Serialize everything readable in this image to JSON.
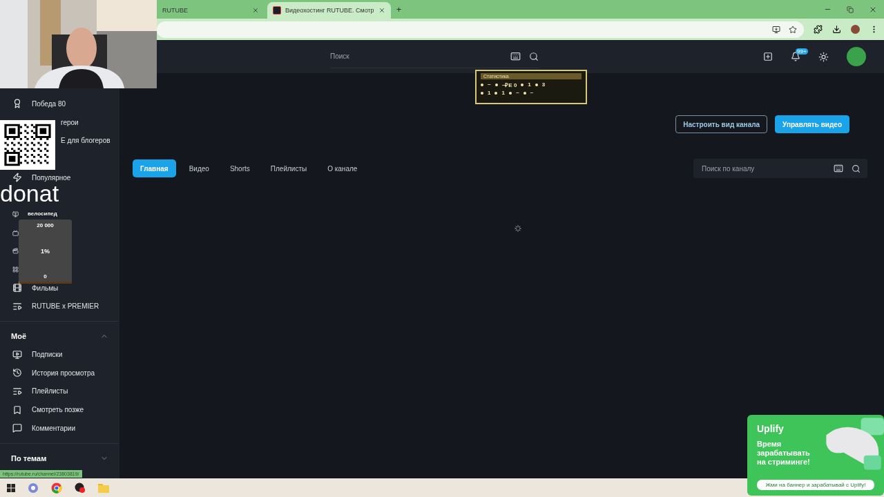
{
  "browser": {
    "tabs": [
      {
        "title": "RUTUBE",
        "selected": false
      },
      {
        "title": "Видеохостинг RUTUBE. Смотр",
        "selected": true
      }
    ],
    "new_tab": "+"
  },
  "header": {
    "search": {
      "placeholder": "Поиск"
    },
    "notifications_badge": "99+"
  },
  "sidebar": {
    "items": [
      {
        "kind": "full",
        "label": "Победа 80"
      },
      {
        "kind": "covered",
        "label": "герои"
      },
      {
        "kind": "covered",
        "label": "Е для блогеров"
      },
      {
        "kind": "hidden"
      },
      {
        "kind": "full",
        "label": "Популярное"
      },
      {
        "kind": "hidden"
      },
      {
        "kind": "icon_only"
      },
      {
        "kind": "icon_only"
      },
      {
        "kind": "icon_only"
      },
      {
        "kind": "icon_only"
      },
      {
        "kind": "full",
        "label": "Фильмы"
      },
      {
        "kind": "full",
        "label": "RUTUBE x PREMIER"
      }
    ],
    "sections": [
      {
        "title": "Моё",
        "expanded": true,
        "items": [
          "Подписки",
          "История просмотра",
          "Плейлисты",
          "Смотреть позже",
          "Комментарии"
        ]
      },
      {
        "title": "По темам",
        "expanded": false
      }
    ]
  },
  "channel": {
    "buttons": [
      {
        "label": "Настроить вид канала",
        "kind": "outline"
      },
      {
        "label": "Управлять видео",
        "kind": "primary"
      }
    ],
    "tabs": [
      {
        "label": "Главная",
        "selected": true
      },
      {
        "label": "Видео",
        "selected": false
      },
      {
        "label": "Shorts",
        "selected": false
      },
      {
        "label": "Плейлисты",
        "selected": false
      },
      {
        "label": "О канале",
        "selected": false
      }
    ],
    "search": {
      "placeholder": "Поиск по каналу"
    }
  },
  "stream_overlay": {
    "donat_label": "donat",
    "goal": {
      "title": "велосипед",
      "target": "20 000",
      "percent": "1%",
      "start": "0",
      "level": 0.01
    },
    "stats": {
      "title": "Статистика",
      "rows": [
        [
          "~",
          "~₽E 0",
          "1",
          "3"
        ],
        [
          "1",
          "1",
          "~",
          "~"
        ]
      ]
    }
  },
  "status_url": "https://rutube.ru/channel/23803819/",
  "ad": {
    "brand": "Uplify",
    "headline": "Время зарабатывать на стриминге!",
    "button": "Жми на баннер и зарабатывай с Uplify!"
  }
}
